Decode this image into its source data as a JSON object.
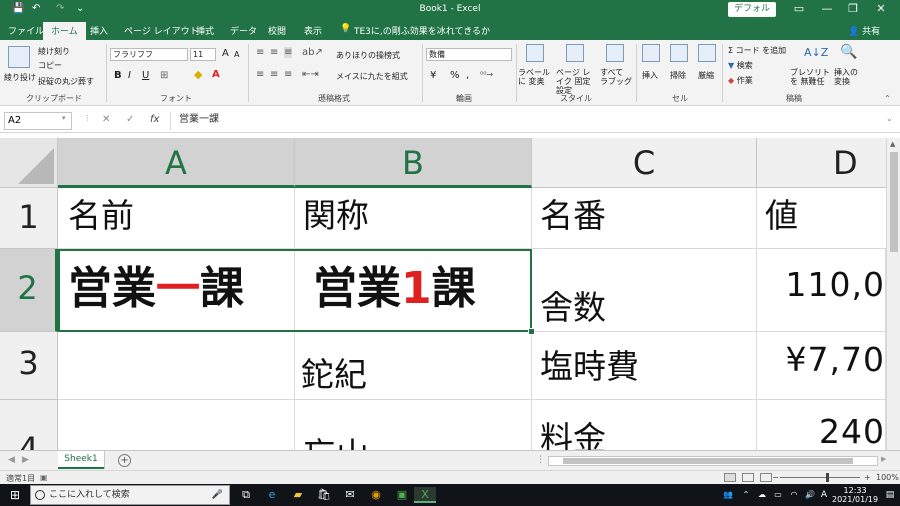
{
  "titlebar": {
    "title": "Book1 - Excel",
    "user": "デフォル",
    "save_icon": "💾",
    "undo_icon": "↶",
    "redo_icon": "↷",
    "qa_more": "⌄",
    "ribbon_opts": "▭",
    "minimize": "—",
    "restore": "❐",
    "close": "✕"
  },
  "tabs": [
    "ファイル",
    "ホーム",
    "挿入",
    "ページ レイアウト",
    "挿式",
    "データ",
    "校閲",
    "表示"
  ],
  "active_tab": "ホーム",
  "tell_me": "TE3に,の剛ふ効果を冰れてきるか",
  "share": "共有",
  "ribbon": {
    "clipboard": {
      "paste": "綾り投け",
      "cut": "綾け刻り",
      "copy": "コピー",
      "painter": "捉碇の丸ジ葬す",
      "label": "クリップボード"
    },
    "font": {
      "name": "フラリフフ",
      "size": "11",
      "grow": "A",
      "shrink": "A",
      "bold": "B",
      "italic": "I",
      "underline": "U",
      "label": "フォント"
    },
    "alignment": {
      "wrap": "ありほりの操榜式",
      "merge": "メイスに九たを組式",
      "label": "遜稿格式"
    },
    "number": {
      "format": "数備",
      "currency": "¥",
      "percent": "%",
      "comma": ",",
      "label": "輪画"
    },
    "styles": {
      "conditional": "ラベールに 変奥",
      "table": "ページ レイク 固定 設定",
      "cell": "すべて ラブッグ",
      "label": "スタイル"
    },
    "cells": {
      "insert": "挿入",
      "delete": "掃除",
      "format": "厳縮",
      "label": "セル"
    },
    "editing": {
      "autosum": "コード を追加",
      "fill": "検索",
      "clear": "作業",
      "sort": "ブレソリトを 無難任",
      "find": "挿入の 変換",
      "label": "稿稿"
    }
  },
  "formula_bar": {
    "name_box": "A2",
    "cancel": "✕",
    "enter": "✓",
    "fx": "fx",
    "formula": "営業一課"
  },
  "colors": {
    "excel_green": "#217346",
    "red": "#e02020"
  },
  "grid": {
    "columns": [
      "A",
      "B",
      "C",
      "D"
    ],
    "selected_columns": [
      "A",
      "B"
    ],
    "rows": [
      "1",
      "2",
      "3",
      "4"
    ],
    "selected_row": "2",
    "cells": {
      "A1": "名前",
      "B1": "関称",
      "C1": "名番",
      "D1": "値",
      "A2": {
        "pre": "営業",
        "mid": "一",
        "post": "課"
      },
      "B2": {
        "pre": "営業",
        "mid": "1",
        "post": "課"
      },
      "C2": "舎数",
      "D2": "110,0",
      "B3": "鉈紀",
      "C3": "塩時費",
      "D3": "¥7,70",
      "B4": "忘山",
      "C4": "料金",
      "D4": "240"
    }
  },
  "sheet_tab": "Sheek1",
  "add_sheet": "+",
  "status": {
    "ready": "適常1目",
    "zoom": "100%",
    "minus": "−",
    "plus": "+"
  },
  "taskbar": {
    "search_placeholder": "ここに入れして検索",
    "time": "12:33",
    "date": "2021/01/19",
    "ime": "A"
  }
}
